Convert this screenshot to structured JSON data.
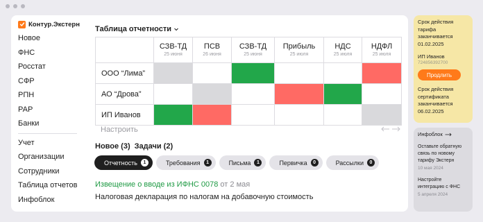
{
  "brand": {
    "name": "Контур.Экстерн"
  },
  "sidebar": {
    "group1": [
      "Новое",
      "ФНС",
      "Росстат",
      "СФР",
      "РПН",
      "РАР",
      "Банки"
    ],
    "group2": [
      "Учет",
      "Организации",
      "Сотрудники",
      "Таблица отчетов",
      "Инфоблок"
    ]
  },
  "main": {
    "title": "Таблица отчетности",
    "columns": [
      {
        "name": "СЗВ-ТД",
        "date": "25 июня"
      },
      {
        "name": "ПСВ",
        "date": "26 июня"
      },
      {
        "name": "СЗВ-ТД",
        "date": "25 июня"
      },
      {
        "name": "Прибыль",
        "date": "25 июля"
      },
      {
        "name": "НДС",
        "date": "25 июля"
      },
      {
        "name": "НДФЛ",
        "date": "25 июля"
      }
    ],
    "rows": [
      {
        "label": "ООО “Лима”",
        "cells": [
          "grey",
          "white",
          "green",
          "white",
          "white",
          "red"
        ]
      },
      {
        "label": "АО “Дрова”",
        "cells": [
          "white",
          "grey",
          "white",
          "red",
          "green",
          "white"
        ]
      },
      {
        "label": "ИП Иванов",
        "cells": [
          "green",
          "red",
          "white",
          "white",
          "white",
          "grey"
        ]
      }
    ],
    "configure": "Настроить",
    "counters": {
      "new": "Новое (3)",
      "tasks": "Задачи (2)"
    },
    "chips": [
      {
        "label": "Отчетность",
        "count": "1",
        "active": true
      },
      {
        "label": "Требования",
        "count": "1",
        "active": false
      },
      {
        "label": "Письма",
        "count": "1",
        "active": false
      },
      {
        "label": "Первичка",
        "count": "0",
        "active": false
      },
      {
        "label": "Рассылки",
        "count": "0",
        "active": false
      }
    ],
    "notice": {
      "link": "Извещение  о вводе из ИФНС 0078",
      "date": "от 2 мая",
      "text": "Налоговая декларация по налогам на добавочную стоимость"
    }
  },
  "tariff": {
    "text": "Срок действия тарифа заканчивается 01.02.2025",
    "user": "ИП Иванов",
    "inn": "724856392700",
    "button": "Продлить",
    "cert_text": "Срок действия сертификата заканчивается 06.02.2025"
  },
  "infoblock": {
    "title": "Инфоблок",
    "items": [
      {
        "text": "Оставьте обратную связь по новому тарифу Экстерн",
        "date": "10 мая 2024"
      },
      {
        "text": "Настройте интеграцию с ФНС",
        "date": "5 апреля 2024"
      }
    ]
  },
  "colors": {
    "green": "#22a74a",
    "red": "#ff6a64",
    "grey": "#d9d9dc",
    "accent": "#ff7a1a",
    "tariff_bg": "#f6e7a6"
  }
}
